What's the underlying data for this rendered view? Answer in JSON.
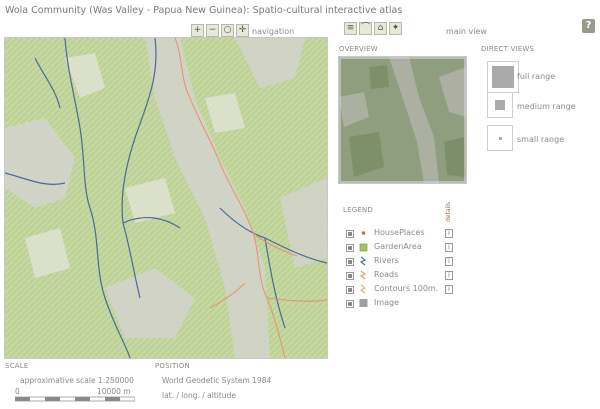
{
  "app": {
    "title": "Wola Community (Was Valley - Papua New Guinea): Spatio-cultural interactive atlas",
    "help_label": "?"
  },
  "toolbar": {
    "navigation_label": "navigation",
    "main_view_label": "main view",
    "nav_icons": [
      "zoom-in-icon",
      "zoom-out-icon",
      "zoom-reset-icon",
      "pan-icon"
    ],
    "view_icons": [
      "list-view-icon",
      "profile-view-icon",
      "house-view-icon",
      "compass-view-icon"
    ]
  },
  "overview": {
    "label": "OVERVIEW"
  },
  "direct_views": {
    "label": "DIRECT VIEWS",
    "items": [
      {
        "label": "full range"
      },
      {
        "label": "medium range"
      },
      {
        "label": "small range"
      }
    ]
  },
  "legend": {
    "label": "LEGEND",
    "details_label": "details",
    "items": [
      {
        "label": "HousePlaces",
        "icon": "house-point-icon",
        "color": "#d06a3a"
      },
      {
        "label": "GardenArea",
        "icon": "garden-area-icon",
        "color": "#a8c060"
      },
      {
        "label": "Rivers",
        "icon": "river-line-icon",
        "color": "#4a6a9a"
      },
      {
        "label": "Roads",
        "icon": "road-line-icon",
        "color": "#e89a6a"
      },
      {
        "label": "Contours 100m.",
        "icon": "contour-line-icon",
        "color": "#d8b080"
      },
      {
        "label": "Image",
        "icon": "image-layer-icon",
        "color": "#a0a0a0"
      }
    ]
  },
  "scale": {
    "label": "SCALE",
    "text": "approximative scale 1:250000",
    "bar_start": "0",
    "bar_end": "10000 m"
  },
  "position": {
    "label": "POSITION",
    "system": "World Geodetic System 1984",
    "coords": "lat. / long. / altitude"
  }
}
